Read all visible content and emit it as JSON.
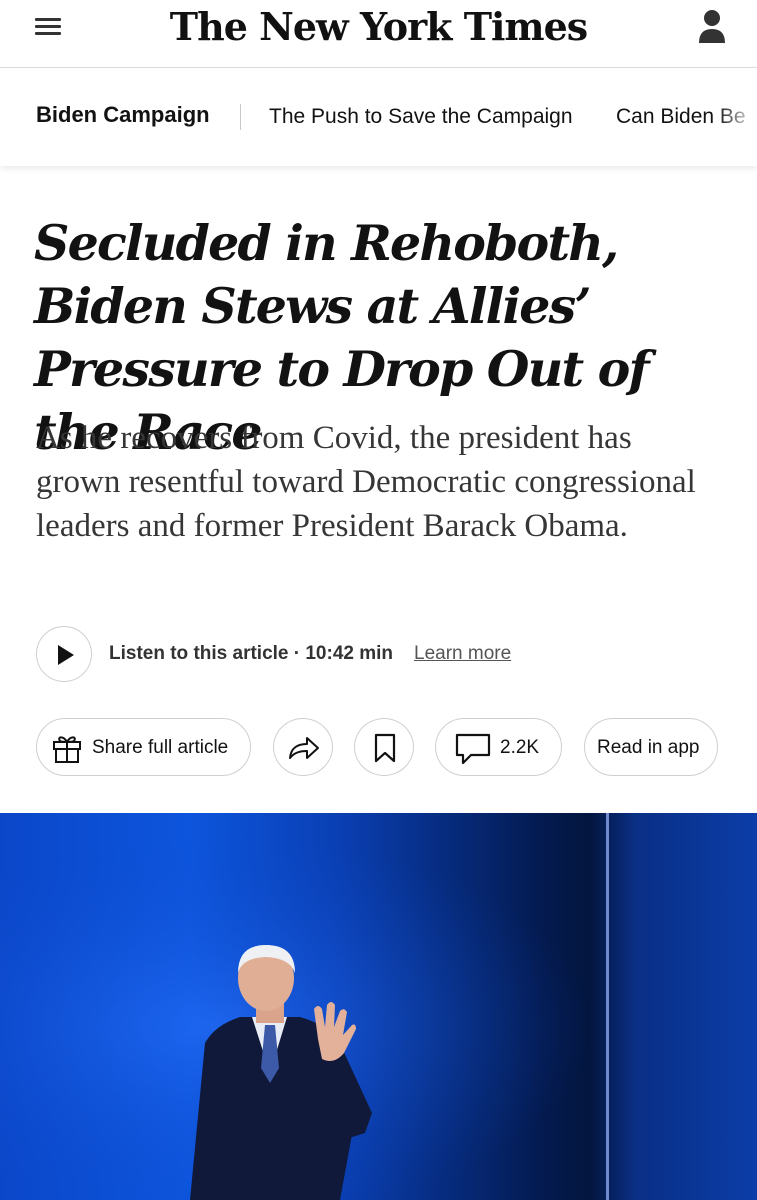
{
  "header": {
    "logo_text": "The New York Times",
    "menu_icon": "hamburger-menu-icon",
    "account_icon": "account-person-icon"
  },
  "story_nav": {
    "section_label": "Biden Campaign",
    "links": [
      "The Push to Save the Campaign",
      "Can Biden Be"
    ]
  },
  "article": {
    "headline": "Secluded in Rehoboth, Biden Stews at Allies’ Pressure to Drop Out of the Race",
    "summary": "As he recovers from Covid, the president has grown resentful toward Democratic congressional leaders and former President Barack Obama."
  },
  "audio": {
    "play_icon": "play-icon",
    "listen_label": "Listen to this article · 10:42 min",
    "learn_more": "Learn more"
  },
  "actions": {
    "share_full_label": "Share full article",
    "gift_icon": "gift-icon",
    "share_icon": "share-arrow-icon",
    "bookmark_icon": "bookmark-icon",
    "comment_icon": "comment-icon",
    "comment_count": "2.2K",
    "read_in_app_label": "Read in app"
  },
  "colors": {
    "text": "#121212",
    "summary_text": "#363636",
    "hero_blue": "#0b47c9",
    "border": "#cfcfcf"
  }
}
